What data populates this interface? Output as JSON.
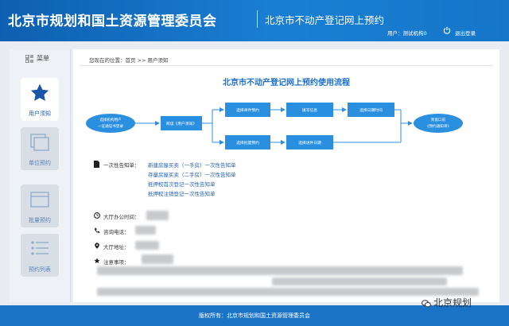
{
  "header": {
    "org_title": "北京市规划和国土资源管理委员会",
    "system_title": "北京市不动产登记网上预约",
    "user_text": "用户：测试机构0",
    "logout_label": "退出登录"
  },
  "sidebar": {
    "menu_label": "菜单",
    "items": [
      {
        "label": "用户须知",
        "icon": "star-icon",
        "active": true
      },
      {
        "label": "单位预约",
        "icon": "document-stack-icon",
        "active": false
      },
      {
        "label": "批量预约",
        "icon": "window-icon",
        "active": false
      },
      {
        "label": "预约列表",
        "icon": "list-icon",
        "active": false
      }
    ]
  },
  "breadcrumb": "您现在的位置：首页 >> 用户须知",
  "flow": {
    "title": "北京市不动产登记网上预约使用流程",
    "start_line1": "选择机构用户",
    "start_line2": "一证通证书登录",
    "read_notice": "阅读《用户须知》",
    "single_booking": "选择单件预约",
    "fill_info": "填写信息",
    "select_date_1": "选择日期时间",
    "batch_booking": "选择批量预约",
    "select_date_2": "选择进件日期",
    "end_line1": "到窗口前",
    "end_line2": "《预约通知单》"
  },
  "notices": {
    "label": "一次性告知单：",
    "items": [
      "新建房屋买卖（一手房）一次性告知单",
      "存量房屋买卖（二手房）一次性告知单",
      "抵押权首次登记一次性告知单",
      "抵押权注销登记一次性告知单"
    ]
  },
  "info": {
    "office_hours_label": "大厅办公时间：",
    "phone_label": "咨询电话：",
    "address_label": "大厅地址：",
    "notes_label": "注意事项："
  },
  "footer": {
    "copyright": "版权所有：北京市规划和国土资源管理委员会"
  },
  "watermark": "北京规划",
  "colors": {
    "brand_blue": "#1a6fc4",
    "flow_box": "#2b8fe0",
    "notice_link": "#2460b5"
  }
}
